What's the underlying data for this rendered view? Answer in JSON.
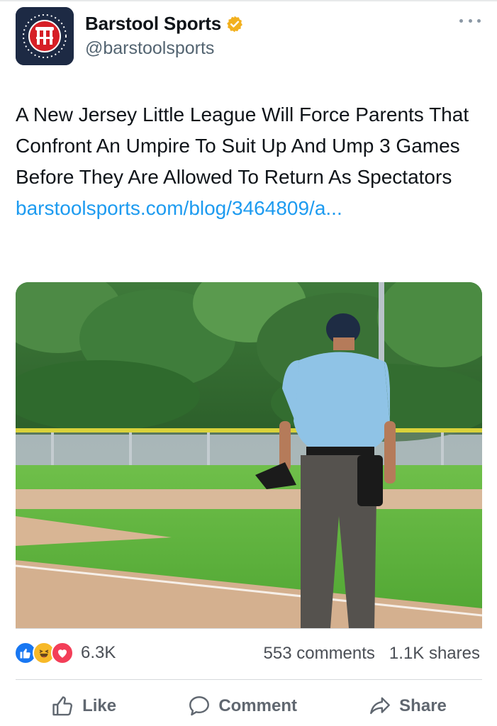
{
  "post": {
    "display_name": "Barstool Sports",
    "handle": "@barstoolsports",
    "verified_icon": "verified-badge-icon",
    "more_icon": "more-icon",
    "text": "A New Jersey Little League Will Force Parents That Confront An Umpire To Suit Up And Ump 3 Games Before They Are Allowed To Return As Spectators ",
    "link": "barstoolsports.com/blog/​3464809/a...",
    "media_alt_icon": "photo-umpire-on-baseball-field"
  },
  "reactions": {
    "icons": [
      "like-reaction-icon",
      "haha-reaction-icon",
      "love-reaction-icon"
    ],
    "count": "6.3K",
    "comments": "553 comments",
    "shares": "1.1K shares"
  },
  "actions": {
    "like_label": "Like",
    "comment_label": "Comment",
    "share_label": "Share"
  },
  "colors": {
    "link": "#1d9bf0",
    "verified": "#f2b01e",
    "like": "#1877f2",
    "love": "#f33e58",
    "haha": "#f7b928",
    "avatar_bg": "#1d2a44",
    "avatar_red": "#d61f26"
  }
}
